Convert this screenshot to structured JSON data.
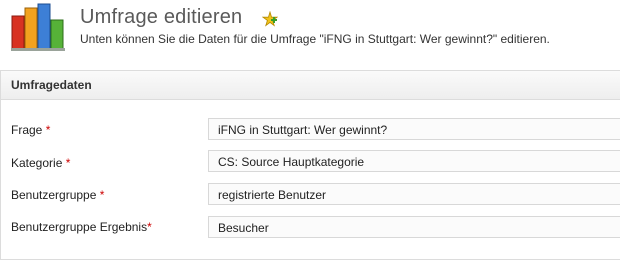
{
  "header": {
    "title": "Umfrage editieren",
    "subtitle": "Unten können Sie die Daten für die Umfrage \"iFNG in Stuttgart: Wer gewinnt?\" editieren.",
    "logo_icon": "bar-chart-icon",
    "add_icon": "add-icon"
  },
  "panel": {
    "title": "Umfragedaten"
  },
  "form": {
    "required_marker": "*",
    "fields": [
      {
        "label": "Frage",
        "value": "iFNG in Stuttgart: Wer gewinnt?"
      },
      {
        "label": "Kategorie",
        "value": "CS: Source Hauptkategorie"
      },
      {
        "label": "Benutzergruppe",
        "value": "registrierte Benutzer"
      },
      {
        "label": "Benutzergruppe Ergebnis",
        "value": "Besucher"
      }
    ]
  },
  "colors": {
    "required": "#cc0000",
    "bar_red": "#e03a2a",
    "bar_orange": "#f5a623",
    "bar_green": "#5bb43a",
    "bar_blue": "#3a7bd5"
  }
}
